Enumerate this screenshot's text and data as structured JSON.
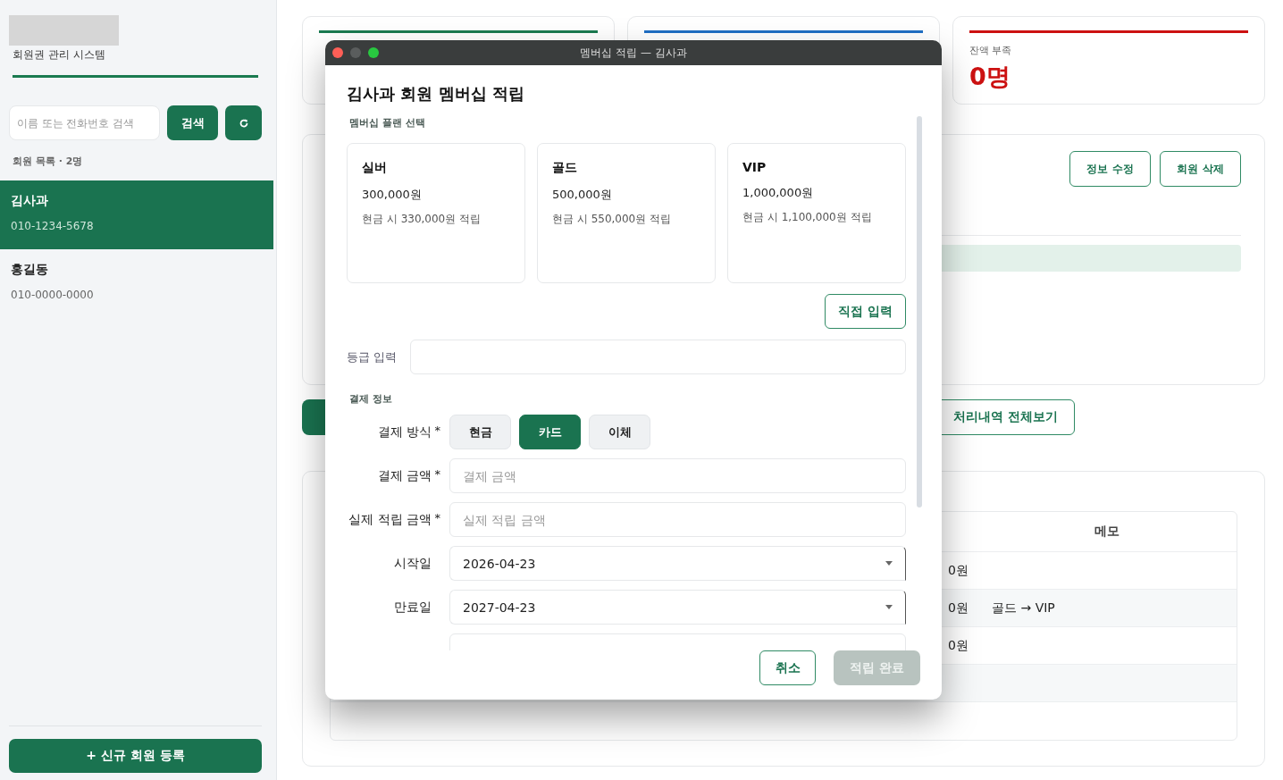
{
  "sidebar": {
    "title": "회원권 관리 시스템",
    "search": {
      "placeholder": "이름 또는 전화번호 검색"
    },
    "search_button": "검색",
    "list_heading": "회원 목록 · 2명",
    "members": [
      {
        "name": "김사과",
        "phone": "010-1234-5678",
        "selected": true
      },
      {
        "name": "홍길동",
        "phone": "010-0000-0000",
        "selected": false
      }
    ],
    "new_member_button": "+ 신규 회원 등록"
  },
  "stats": [
    {
      "color": "#1a7a50"
    },
    {
      "color": "#1f6fc4"
    },
    {
      "color": "#cc1111",
      "label": "잔액 부족",
      "value": "0명"
    }
  ],
  "detail": {
    "buttons": [
      "정보 수정",
      "회원 삭제"
    ]
  },
  "history_button": "처리내역 전체보기",
  "history_table": {
    "columns": [
      "메모"
    ],
    "rows": [
      {
        "amount": "0원"
      },
      {
        "amount": "0원",
        "memo": "골드 → VIP"
      },
      {
        "amount": "0원"
      }
    ]
  },
  "dialog": {
    "window_title": "멤버십 적립 — 김사과",
    "heading": "김사과 회원 멤버십 적립",
    "plan_section": "멤버십 플랜 선택",
    "plans": [
      {
        "name": "실버",
        "price": "300,000원",
        "bonus": "현금 시 330,000원 적립"
      },
      {
        "name": "골드",
        "price": "500,000원",
        "bonus": "현금 시 550,000원 적립"
      },
      {
        "name": "VIP",
        "price": "1,000,000원",
        "bonus": "현금 시 1,100,000원 적립"
      }
    ],
    "custom_button": "직접 입력",
    "grade_label": "등급 입력",
    "payment_section": "결제 정보",
    "payment_method": {
      "label": "결제 방식",
      "required_mark": "*",
      "options": [
        {
          "label": "현금",
          "selected": false
        },
        {
          "label": "카드",
          "selected": true
        },
        {
          "label": "이체",
          "selected": false
        }
      ]
    },
    "fields": [
      {
        "kind": "text",
        "label": "결제 금액",
        "required_mark": "*",
        "placeholder": "결제 금액"
      },
      {
        "kind": "text",
        "label": "실제 적립 금액",
        "required_mark": "*",
        "placeholder": "실제 적립 금액"
      },
      {
        "kind": "date",
        "label": "시작일",
        "value": "2026-04-23"
      },
      {
        "kind": "date",
        "label": "만료일",
        "value": "2027-04-23"
      }
    ],
    "cancel_button": "취소",
    "submit_button": {
      "label": "적립 완료",
      "disabled": true
    }
  }
}
